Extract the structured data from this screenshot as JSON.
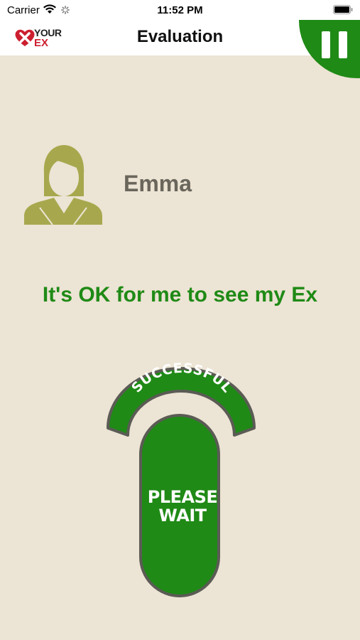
{
  "status_bar": {
    "carrier": "Carrier",
    "time": "11:52 PM"
  },
  "nav": {
    "title": "Evaluation",
    "logo_your": "YOUR",
    "logo_ex": "EX"
  },
  "profile": {
    "name": "Emma"
  },
  "statement": "It's OK for me to see my Ex",
  "control": {
    "arc_label": "SUCCESSFUL",
    "button_line1": "PLEASE",
    "button_line2": "WAIT"
  },
  "colors": {
    "background": "#ece4d4",
    "brand_green": "#1f8a16",
    "avatar_olive": "#a7a84e",
    "border_gray": "#5b5b55",
    "logo_red": "#cc1f2f"
  },
  "icons": [
    "wifi-icon",
    "spinner-icon",
    "battery-icon",
    "pause-icon",
    "heart-x-logo-icon",
    "person-avatar-icon"
  ]
}
